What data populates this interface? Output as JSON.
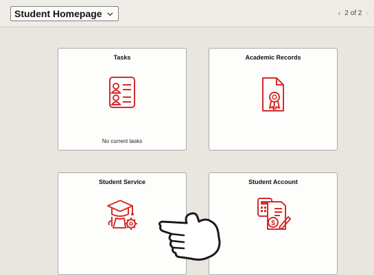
{
  "header": {
    "homepage_label": "Student Homepage",
    "pager_text": "2 of 2",
    "prev_icon": "chevron-left-icon",
    "next_icon": "chevron-right-icon"
  },
  "tiles": [
    {
      "title": "Tasks",
      "note": "No current tasks",
      "icon": "task-list-icon"
    },
    {
      "title": "Academic Records",
      "icon": "certificate-document-icon"
    },
    {
      "title": "Student Service",
      "icon": "graduation-cap-gear-icon"
    },
    {
      "title": "Student Account",
      "icon": "calculator-invoice-icon"
    }
  ],
  "colors": {
    "accent": "#d42b2b",
    "background": "#e9e6e0",
    "tile": "#fdfdfc"
  },
  "overlay": {
    "icon": "pointing-hand-cursor-icon"
  }
}
